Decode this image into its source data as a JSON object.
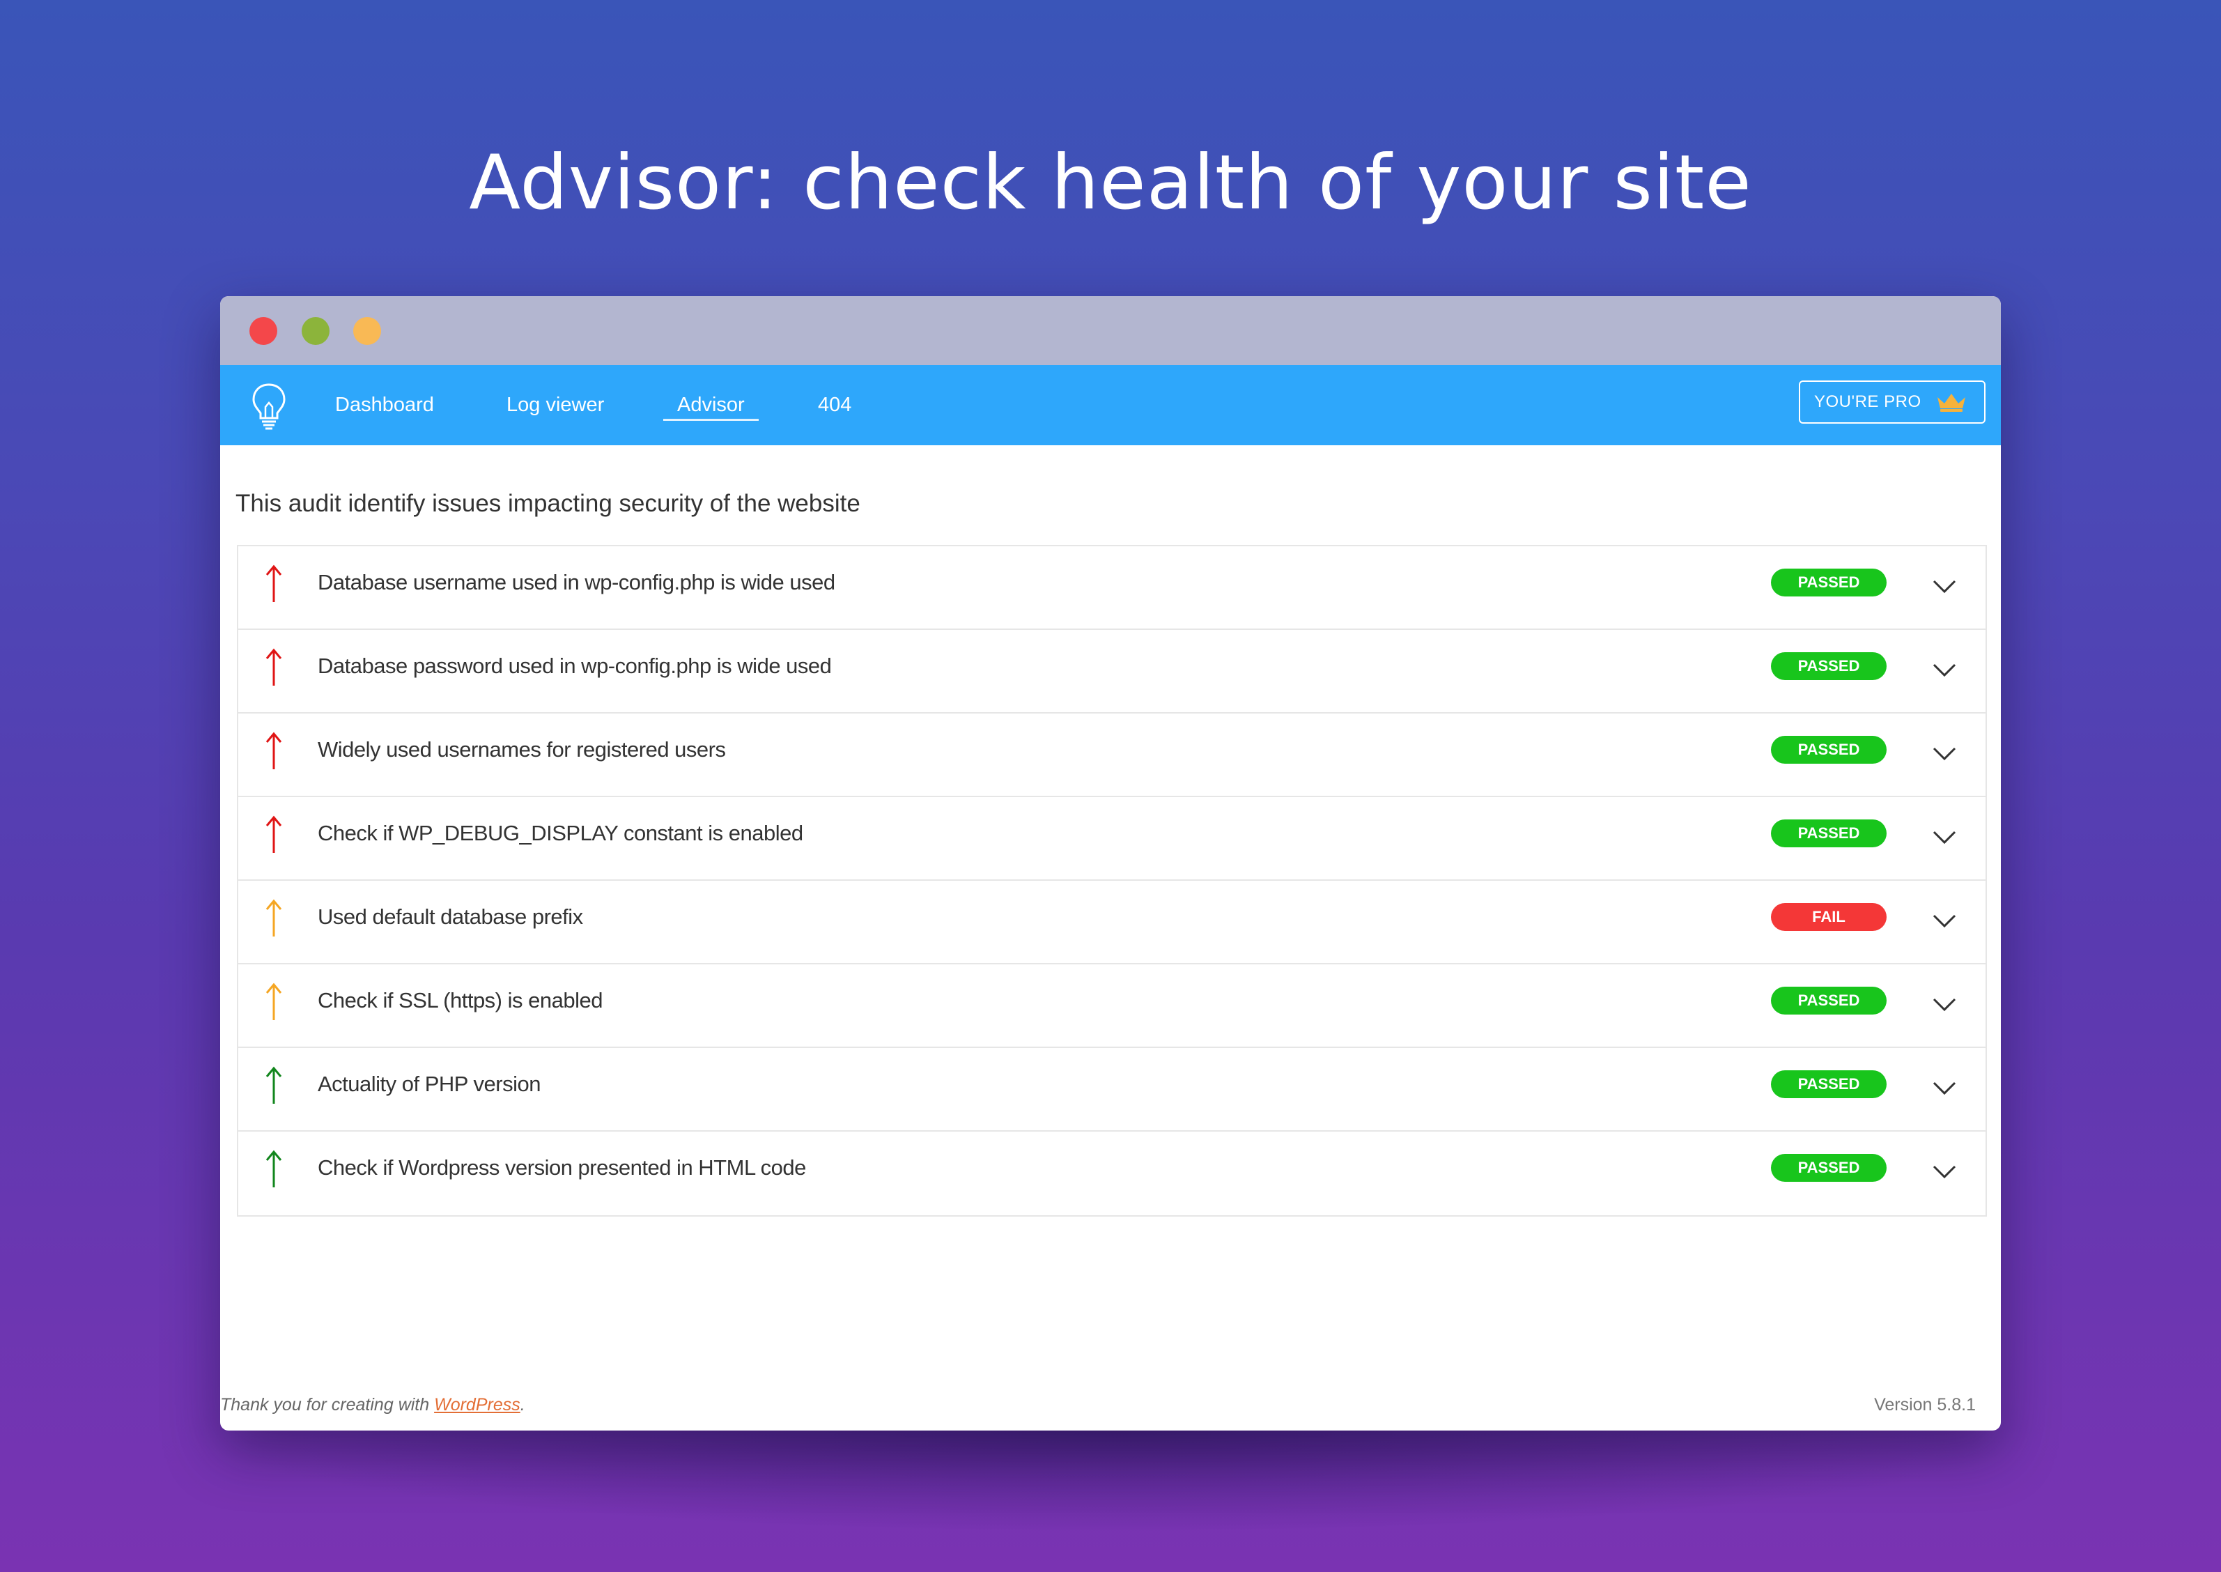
{
  "headline": "Advisor: check health of your site",
  "nav": {
    "items": [
      {
        "label": "Dashboard"
      },
      {
        "label": "Log viewer"
      },
      {
        "label": "Advisor"
      },
      {
        "label": "404"
      }
    ],
    "active": "Advisor",
    "pro_label": "YOU'RE PRO"
  },
  "audit": {
    "title": "This audit identify issues impacting security of the website",
    "items": [
      {
        "label": "Database username used in wp-config.php is wide used",
        "priority": "high",
        "arrow_color": "#e01515",
        "status": "PASSED"
      },
      {
        "label": "Database password used in wp-config.php is wide used",
        "priority": "high",
        "arrow_color": "#e01515",
        "status": "PASSED"
      },
      {
        "label": "Widely used usernames for registered users",
        "priority": "high",
        "arrow_color": "#e01515",
        "status": "PASSED"
      },
      {
        "label": "Check if WP_DEBUG_DISPLAY constant is enabled",
        "priority": "high",
        "arrow_color": "#e01515",
        "status": "PASSED"
      },
      {
        "label": "Used default database prefix",
        "priority": "medium",
        "arrow_color": "#f5a623",
        "status": "FAIL"
      },
      {
        "label": "Check if SSL (https) is enabled",
        "priority": "medium",
        "arrow_color": "#f5a623",
        "status": "PASSED"
      },
      {
        "label": "Actuality of PHP version",
        "priority": "low",
        "arrow_color": "#12861d",
        "status": "PASSED"
      },
      {
        "label": "Check if Wordpress version presented in HTML code",
        "priority": "low",
        "arrow_color": "#12861d",
        "status": "PASSED"
      }
    ]
  },
  "footer": {
    "thanks_prefix": "Thank you for creating with ",
    "link_text": "WordPress",
    "thanks_suffix": ".",
    "version": "Version 5.8.1"
  },
  "colors": {
    "navbar": "#2ea7fb",
    "passed": "#18c51c",
    "fail": "#f43737",
    "link": "#e36e35"
  },
  "icons": {
    "logo": "lightbulb-icon",
    "pro": "crown-icon",
    "priority": "arrow-up-icon",
    "expand": "chevron-down-icon"
  }
}
